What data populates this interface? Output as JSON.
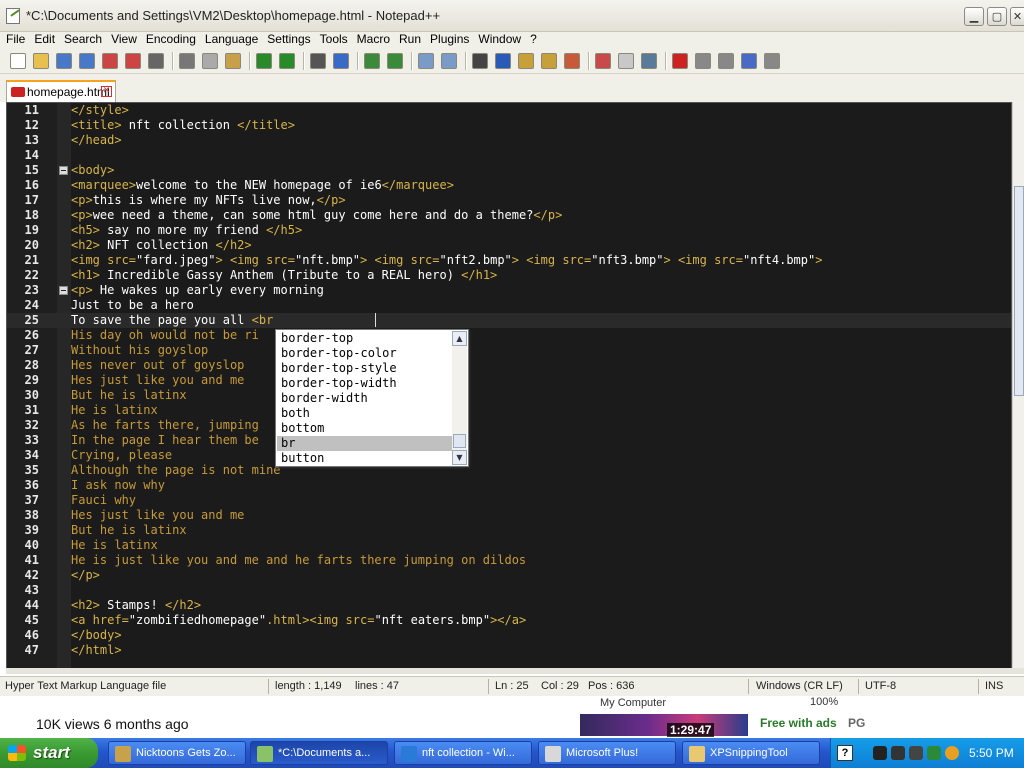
{
  "window": {
    "title": "*C:\\Documents and Settings\\VM2\\Desktop\\homepage.html - Notepad++",
    "min_icon": "minimize-icon",
    "max_icon": "maximize-icon",
    "close_icon": "close-icon",
    "min_glyph": "▁",
    "max_glyph": "▢",
    "close_glyph": "✕"
  },
  "menu": [
    "File",
    "Edit",
    "Search",
    "View",
    "Encoding",
    "Language",
    "Settings",
    "Tools",
    "Macro",
    "Run",
    "Plugins",
    "Window",
    "?"
  ],
  "toolbar": {
    "icons": [
      "new-file-icon",
      "open-file-icon",
      "save-icon",
      "save-all-icon",
      "close-icon",
      "close-all-icon",
      "print-icon",
      "cut-icon",
      "copy-icon",
      "paste-icon",
      "undo-icon",
      "redo-icon",
      "find-icon",
      "replace-icon",
      "zoom-in-icon",
      "zoom-out-icon",
      "sync-vertical-icon",
      "sync-horizontal-icon",
      "word-wrap-icon",
      "show-all-chars-icon",
      "indent-guide-icon",
      "udl-icon",
      "doc-map-icon",
      "function-list-icon",
      "folder-workspace-icon",
      "monitoring-icon",
      "record-macro-icon",
      "stop-macro-icon",
      "play-macro-icon",
      "run-macro-multiple-icon",
      "save-macro-icon"
    ]
  },
  "tab": {
    "label": "homepage.html",
    "close_glyph": "✕"
  },
  "editor": {
    "lines": [
      {
        "n": "11",
        "segs": [
          [
            "tag",
            "</style>"
          ]
        ]
      },
      {
        "n": "12",
        "segs": [
          [
            "tag",
            "<title>"
          ],
          [
            "plain",
            " nft collection "
          ],
          [
            "tag",
            "</title>"
          ]
        ]
      },
      {
        "n": "13",
        "segs": [
          [
            "tag",
            "</head>"
          ]
        ]
      },
      {
        "n": "14",
        "segs": []
      },
      {
        "n": "15",
        "fold": true,
        "segs": [
          [
            "tag",
            "<body>"
          ]
        ]
      },
      {
        "n": "16",
        "segs": [
          [
            "tag",
            "<marquee>"
          ],
          [
            "plain",
            "welcome to the NEW homepage of ie6"
          ],
          [
            "tag",
            "</marquee>"
          ]
        ]
      },
      {
        "n": "17",
        "segs": [
          [
            "tag",
            "<p>"
          ],
          [
            "plain",
            "this is where my NFTs live now,"
          ],
          [
            "tag",
            "</p>"
          ]
        ]
      },
      {
        "n": "18",
        "segs": [
          [
            "tag",
            "<p>"
          ],
          [
            "plain",
            "wee need a theme, can some html guy come here and do a theme?"
          ],
          [
            "tag",
            "</p>"
          ]
        ]
      },
      {
        "n": "19",
        "segs": [
          [
            "tag",
            "<h5>"
          ],
          [
            "plain",
            " say no more my friend "
          ],
          [
            "tag",
            "</h5>"
          ]
        ]
      },
      {
        "n": "20",
        "segs": [
          [
            "tag",
            "<h2>"
          ],
          [
            "plain",
            " NFT collection "
          ],
          [
            "tag",
            "</h2>"
          ]
        ]
      },
      {
        "n": "21",
        "segs": [
          [
            "tag",
            "<img src="
          ],
          [
            "str",
            "\"fard.jpeg\""
          ],
          [
            "tag",
            "> <img src="
          ],
          [
            "str",
            "\"nft.bmp\""
          ],
          [
            "tag",
            "> <img src="
          ],
          [
            "str",
            "\"nft2.bmp\""
          ],
          [
            "tag",
            "> <img src="
          ],
          [
            "str",
            "\"nft3.bmp\""
          ],
          [
            "tag",
            "> <img src="
          ],
          [
            "str",
            "\"nft4.bmp\""
          ],
          [
            "tag",
            ">"
          ]
        ]
      },
      {
        "n": "22",
        "segs": [
          [
            "tag",
            "<h1>"
          ],
          [
            "plain",
            " Incredible Gassy Anthem (Tribute to a REAL hero) "
          ],
          [
            "tag",
            "</h1>"
          ]
        ]
      },
      {
        "n": "23",
        "fold": true,
        "segs": [
          [
            "tag",
            "<p>"
          ],
          [
            "plain",
            " He wakes up early every morning"
          ]
        ]
      },
      {
        "n": "24",
        "segs": [
          [
            "plain",
            "Just to be a hero"
          ]
        ]
      },
      {
        "n": "25",
        "current": true,
        "segs": [
          [
            "plain",
            "To save the page you all "
          ],
          [
            "tag",
            "<br"
          ]
        ]
      },
      {
        "n": "26",
        "segs": [
          [
            "dim",
            "His day oh would not be ri"
          ]
        ]
      },
      {
        "n": "27",
        "segs": [
          [
            "dim",
            "Without his goyslop"
          ]
        ]
      },
      {
        "n": "28",
        "segs": [
          [
            "dim",
            "Hes never out of goyslop"
          ]
        ]
      },
      {
        "n": "29",
        "segs": [
          [
            "dim",
            "Hes just like you and me"
          ]
        ]
      },
      {
        "n": "30",
        "segs": [
          [
            "dim",
            "But he is latinx"
          ]
        ]
      },
      {
        "n": "31",
        "segs": [
          [
            "dim",
            "He is latinx"
          ]
        ]
      },
      {
        "n": "32",
        "segs": [
          [
            "dim",
            "As he farts there, jumping"
          ]
        ]
      },
      {
        "n": "33",
        "segs": [
          [
            "dim",
            "In the page I hear them be"
          ]
        ]
      },
      {
        "n": "34",
        "segs": [
          [
            "dim",
            "Crying, please"
          ]
        ]
      },
      {
        "n": "35",
        "segs": [
          [
            "dim",
            "Although the page is not mine"
          ]
        ]
      },
      {
        "n": "36",
        "segs": [
          [
            "dim",
            "I ask now why"
          ]
        ]
      },
      {
        "n": "37",
        "segs": [
          [
            "dim",
            "Fauci why"
          ]
        ]
      },
      {
        "n": "38",
        "segs": [
          [
            "dim",
            "Hes just like you and me"
          ]
        ]
      },
      {
        "n": "39",
        "segs": [
          [
            "dim",
            "But he is latinx"
          ]
        ]
      },
      {
        "n": "40",
        "segs": [
          [
            "dim",
            "He is latinx"
          ]
        ]
      },
      {
        "n": "41",
        "segs": [
          [
            "dim",
            "He is just like you and me and he farts there jumping on dildos"
          ]
        ]
      },
      {
        "n": "42",
        "segs": [
          [
            "tag",
            "</p>"
          ]
        ]
      },
      {
        "n": "43",
        "segs": []
      },
      {
        "n": "44",
        "segs": [
          [
            "tag",
            "<h2>"
          ],
          [
            "plain",
            " Stamps! "
          ],
          [
            "tag",
            "</h2>"
          ]
        ]
      },
      {
        "n": "45",
        "segs": [
          [
            "tag",
            "<a href="
          ],
          [
            "str",
            "\"zombifiedhomepage\""
          ],
          [
            "tag",
            ".html>"
          ],
          [
            "tag",
            "<img src="
          ],
          [
            "str",
            "\"nft eaters.bmp\""
          ],
          [
            "tag",
            "></a>"
          ]
        ]
      },
      {
        "n": "46",
        "segs": [
          [
            "tag",
            "</body>"
          ]
        ]
      },
      {
        "n": "47",
        "segs": [
          [
            "tag",
            "</html>"
          ]
        ]
      }
    ]
  },
  "autocomplete": {
    "items": [
      "border-top",
      "border-top-color",
      "border-top-style",
      "border-top-width",
      "border-width",
      "both",
      "bottom",
      "br",
      "button"
    ],
    "selected": "br",
    "up_glyph": "▲",
    "down_glyph": "▼"
  },
  "statusbar": {
    "filetype": "Hyper Text Markup Language file",
    "length": "length : 1,149",
    "lines": "lines : 47",
    "ln": "Ln : 25",
    "col": "Col : 29",
    "pos": "Pos : 636",
    "eol": "Windows (CR LF)",
    "encoding": "UTF-8",
    "mode": "INS"
  },
  "overlay": {
    "views": "10K views  6 months ago",
    "my_computer": "My Computer",
    "zoom": "100%",
    "video_time": "1:29:47",
    "free_with_ads": "Free with ads",
    "pg": "PG"
  },
  "taskbar": {
    "start": "start",
    "tasks": [
      {
        "label": "Nicktoons Gets Zo...",
        "icon_color": "#c8a24a"
      },
      {
        "label": "*C:\\Documents a...",
        "icon_color": "#8ac26a",
        "active": true
      },
      {
        "label": "nft collection - Wi...",
        "icon_color": "#2a7ad8"
      },
      {
        "label": "Microsoft Plus!",
        "icon_color": "#d8d8d8"
      },
      {
        "label": "XPSnippingTool",
        "icon_color": "#e8c870"
      }
    ],
    "help_glyph": "?",
    "clock": "5:50 PM"
  },
  "colors": {
    "tag": "#d8b44a",
    "text": "#ffffff",
    "dim": "#c79a3a",
    "editor_bg": "#1b1b1b",
    "taskbar": "#2457cc",
    "start": "#3a9a32"
  }
}
